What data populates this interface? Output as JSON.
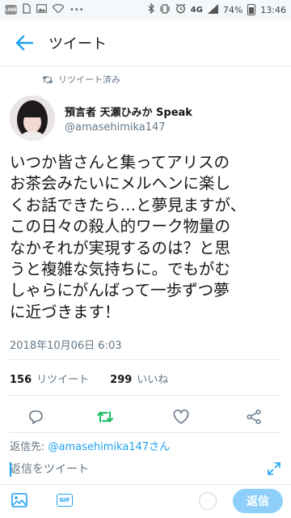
{
  "status_bar": {
    "battery": "74%",
    "network": "4G",
    "time": "13:46",
    "left_icons": [
      "line-app-icon",
      "sim-icon",
      "image-icon",
      "wifi-icon",
      "more-dots-icon"
    ],
    "right_icons": [
      "bluetooth-icon",
      "vibrate-icon",
      "alarm-icon",
      "network-4g-icon",
      "signal-icon",
      "battery-icon"
    ]
  },
  "header": {
    "title": "ツイート",
    "back_icon": "arrow-left-icon"
  },
  "tweet": {
    "retweet_label": "リツイート済み",
    "author_name": "預言者 天瀬ひみか Speak",
    "handle": "@amasehimika147",
    "text_lines": [
      "いつか皆さんと集ってアリスの",
      "お茶会みたいにメルヘンに楽し",
      "くお話できたら…と夢見ますが、",
      "この日々の殺人的ワーク物量の",
      "なかそれが実現するのは？と思",
      "うと複雑な気持ちに。でもがむ",
      "しゃらにがんばって一歩ずつ夢",
      "に近づきます！"
    ],
    "timestamp": "2018年10月06日 6:03",
    "retweet_count": "156",
    "retweet_word": "リツイート",
    "like_count": "299",
    "like_word": "いいね"
  },
  "actions": {
    "icons": [
      "reply-icon",
      "retweet-icon",
      "like-icon",
      "share-icon"
    ],
    "retweet_active_color": "#17bf63",
    "default_color": "#657786"
  },
  "reply": {
    "label": "返信先:",
    "mention": "@amasehimika147さん",
    "placeholder": "返信をツイート",
    "gif_label": "GIF",
    "button_label": "返信",
    "accent": "#1da1f2"
  }
}
